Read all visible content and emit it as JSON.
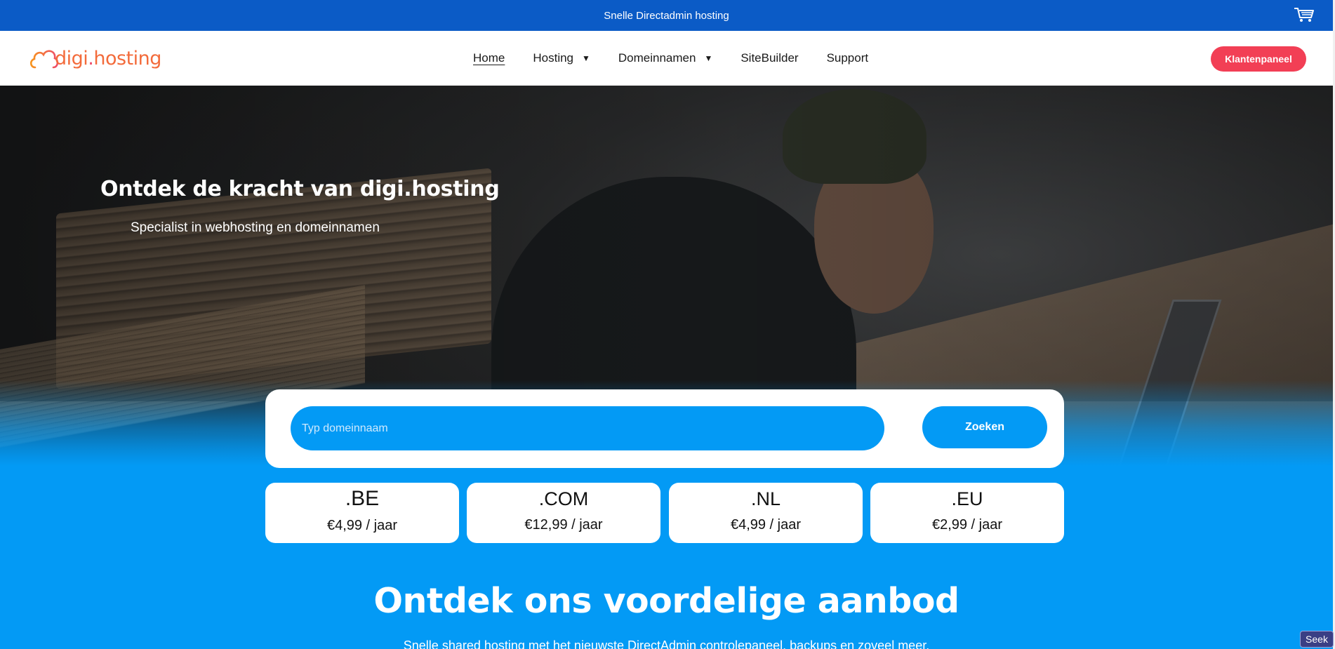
{
  "topbar": {
    "text": "Snelle Directadmin hosting",
    "cart_icon": "cart-icon"
  },
  "header": {
    "logo_prefix": "digi",
    "logo_dot": ".",
    "logo_suffix": "hosting",
    "nav": [
      {
        "label": "Home",
        "active": true,
        "dropdown": false
      },
      {
        "label": "Hosting",
        "active": false,
        "dropdown": true
      },
      {
        "label": "Domeinnamen",
        "active": false,
        "dropdown": true
      },
      {
        "label": "SiteBuilder",
        "active": false,
        "dropdown": false
      },
      {
        "label": "Support",
        "active": false,
        "dropdown": false
      }
    ],
    "caret": "▼",
    "cta_label": "Klantenpaneel"
  },
  "hero": {
    "title": "Ontdek de kracht van digi.hosting",
    "subtitle": "Specialist in webhosting en domeinnamen"
  },
  "search": {
    "placeholder": "Typ domeinnaam",
    "button_label": "Zoeken"
  },
  "tlds": [
    {
      "ext": ".BE",
      "price": "€4,99 / jaar"
    },
    {
      "ext": ".COM",
      "price": "€12,99 / jaar"
    },
    {
      "ext": ".NL",
      "price": "€4,99 / jaar"
    },
    {
      "ext": ".EU",
      "price": "€2,99 / jaar"
    }
  ],
  "offer": {
    "title": "Ontdek ons voordelige aanbod",
    "subtitle": "Snelle shared hosting met het nieuwste DirectAdmin controlepaneel, backups en zoveel meer."
  },
  "badge": {
    "label": "Seek"
  },
  "colors": {
    "topbar": "#0b5bc6",
    "accent_blue": "#039af5",
    "cta_red": "#f23f55",
    "logo_orange": "#f36b3b"
  }
}
